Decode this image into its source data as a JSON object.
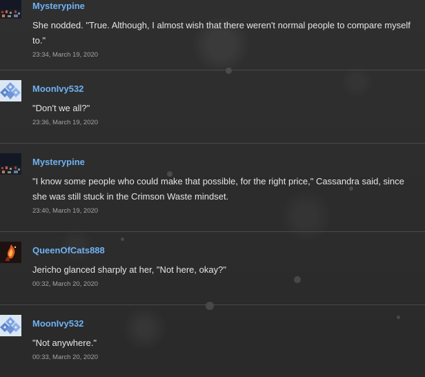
{
  "colors": {
    "background": "#2b2b2b",
    "author": "#6fb2f2",
    "message_text": "#e5e5e5",
    "timestamp": "#a5a5a5",
    "divider": "#4a4a4a"
  },
  "messages": [
    {
      "author": "Mysterypine",
      "text": "She nodded. \"True. Although, I almost wish that there weren't normal people to compare myself to.\"",
      "timestamp": "23:34, March 19, 2020",
      "avatar_icon": "city-night-avatar-icon"
    },
    {
      "author": "MoonIvy532",
      "text": "\"Don't we all?\"",
      "timestamp": "23:36, March 19, 2020",
      "avatar_icon": "blue-crystal-avatar-icon"
    },
    {
      "author": "Mysterypine",
      "text": "\"I know some people who could make that possible, for the right price,\" Cassandra said, since she was still stuck in the Crimson Waste mindset.",
      "timestamp": "23:40, March 19, 2020",
      "avatar_icon": "city-night-avatar-icon"
    },
    {
      "author": "QueenOfCats888",
      "text": "Jericho glanced sharply at her, \"Not here, okay?\"",
      "timestamp": "00:32, March 20, 2020",
      "avatar_icon": "flame-avatar-icon"
    },
    {
      "author": "MoonIvy532",
      "text": "\"Not anywhere.\"",
      "timestamp": "00:33, March 20, 2020",
      "avatar_icon": "blue-crystal-avatar-icon"
    }
  ]
}
